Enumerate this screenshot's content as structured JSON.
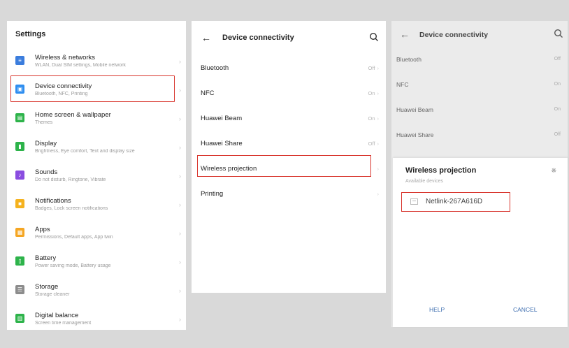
{
  "settings": {
    "title": "Settings",
    "items": [
      {
        "title": "Wireless & networks",
        "subtitle": "WLAN, Dual SIM settings, Mobile network",
        "icon": "wifi-icon",
        "color": "#3b7ddd"
      },
      {
        "title": "Device connectivity",
        "subtitle": "Bluetooth, NFC, Printing",
        "icon": "device-connectivity-icon",
        "color": "#2f8ef0"
      },
      {
        "title": "Home screen & wallpaper",
        "subtitle": "Themes",
        "icon": "home-screen-icon",
        "color": "#2db34a"
      },
      {
        "title": "Display",
        "subtitle": "Brightness, Eye comfort, Text and display size",
        "icon": "display-icon",
        "color": "#2db34a"
      },
      {
        "title": "Sounds",
        "subtitle": "Do not disturb, Ringtone, Vibrate",
        "icon": "sound-icon",
        "color": "#8a4de0"
      },
      {
        "title": "Notifications",
        "subtitle": "Badges, Lock screen notifications",
        "icon": "notifications-icon",
        "color": "#f5b21e"
      },
      {
        "title": "Apps",
        "subtitle": "Permissions, Default apps, App twin",
        "icon": "apps-icon",
        "color": "#f5a623"
      },
      {
        "title": "Battery",
        "subtitle": "Power saving mode, Battery usage",
        "icon": "battery-icon",
        "color": "#2db34a"
      },
      {
        "title": "Storage",
        "subtitle": "Storage cleaner",
        "icon": "storage-icon",
        "color": "#8c8c8c"
      },
      {
        "title": "Digital balance",
        "subtitle": "Screen time management",
        "icon": "digital-balance-icon",
        "color": "#2db34a"
      }
    ]
  },
  "connectivity": {
    "title": "Device connectivity",
    "items": [
      {
        "label": "Bluetooth",
        "value": "Off"
      },
      {
        "label": "NFC",
        "value": "On"
      },
      {
        "label": "Huawei Beam",
        "value": "On"
      },
      {
        "label": "Huawei Share",
        "value": "Off"
      },
      {
        "label": "Wireless projection",
        "value": ""
      },
      {
        "label": "Printing",
        "value": ""
      }
    ]
  },
  "projection_screen": {
    "title": "Device connectivity",
    "items": [
      {
        "label": "Bluetooth",
        "value": "Off"
      },
      {
        "label": "NFC",
        "value": "On"
      },
      {
        "label": "Huawei Beam",
        "value": "On"
      },
      {
        "label": "Huawei Share",
        "value": "Off"
      }
    ],
    "dialog": {
      "title": "Wireless projection",
      "subtitle": "Available devices",
      "device": "Netlink-267A616D",
      "help": "HELP",
      "cancel": "CANCEL"
    }
  },
  "accent_color": "#d8342c"
}
